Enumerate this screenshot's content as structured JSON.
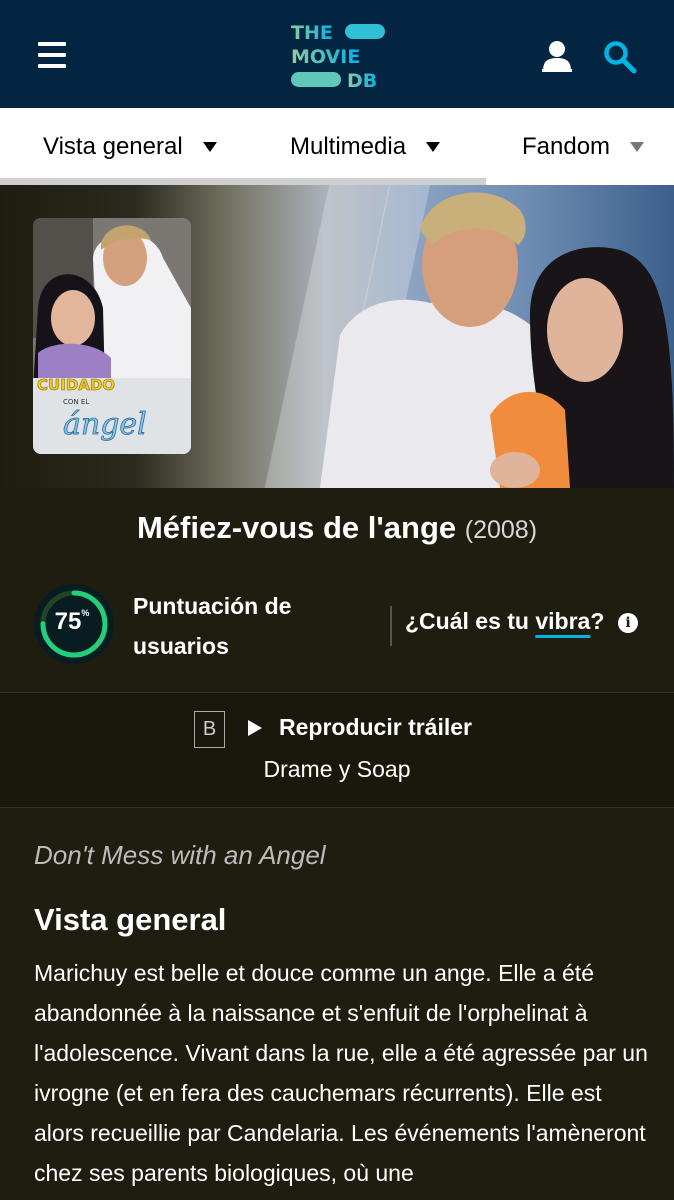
{
  "header": {
    "logo_lines": [
      "THE",
      "MOVIE",
      "DB"
    ],
    "menu_icon": "hamburger-menu-icon",
    "user_icon": "user-icon",
    "search_icon": "search-icon",
    "colors": {
      "background": "#032541",
      "logo_teal": "#90cea1",
      "logo_blue": "#01b4e4"
    }
  },
  "tabs": [
    {
      "label": "Vista general"
    },
    {
      "label": "Multimedia"
    },
    {
      "label": "Fandom"
    }
  ],
  "poster": {
    "title_art": [
      "CUIDADO",
      "CON EL",
      "ángel"
    ]
  },
  "movie": {
    "title": "Méfiez-vous de l'ange",
    "year": "(2008)"
  },
  "score": {
    "value": "75",
    "unit": "%",
    "percent": 75,
    "label": "Puntuación de usuarios",
    "ring_color": "#21d07a"
  },
  "vibe": {
    "prefix": "¿Cuál es tu ",
    "link": "vibra",
    "suffix": "?",
    "info_icon": "i"
  },
  "facts": {
    "certification": "B",
    "trailer_label": "Reproducir tráiler",
    "genres": "Drame y Soap"
  },
  "overview": {
    "tagline": "Don't Mess with an Angel",
    "heading": "Vista general",
    "text": "Marichuy est belle et douce comme un ange. Elle a été abandonnée à la naissance et s'enfuit de l'orphelinat à l'adolescence. Vivant dans la rue, elle a été agressée par un ivrogne (et en fera des cauchemars récurrents). Elle est alors recueillie par Candelaria. Les événements l'amèneront chez ses parents biologiques, où une"
  }
}
